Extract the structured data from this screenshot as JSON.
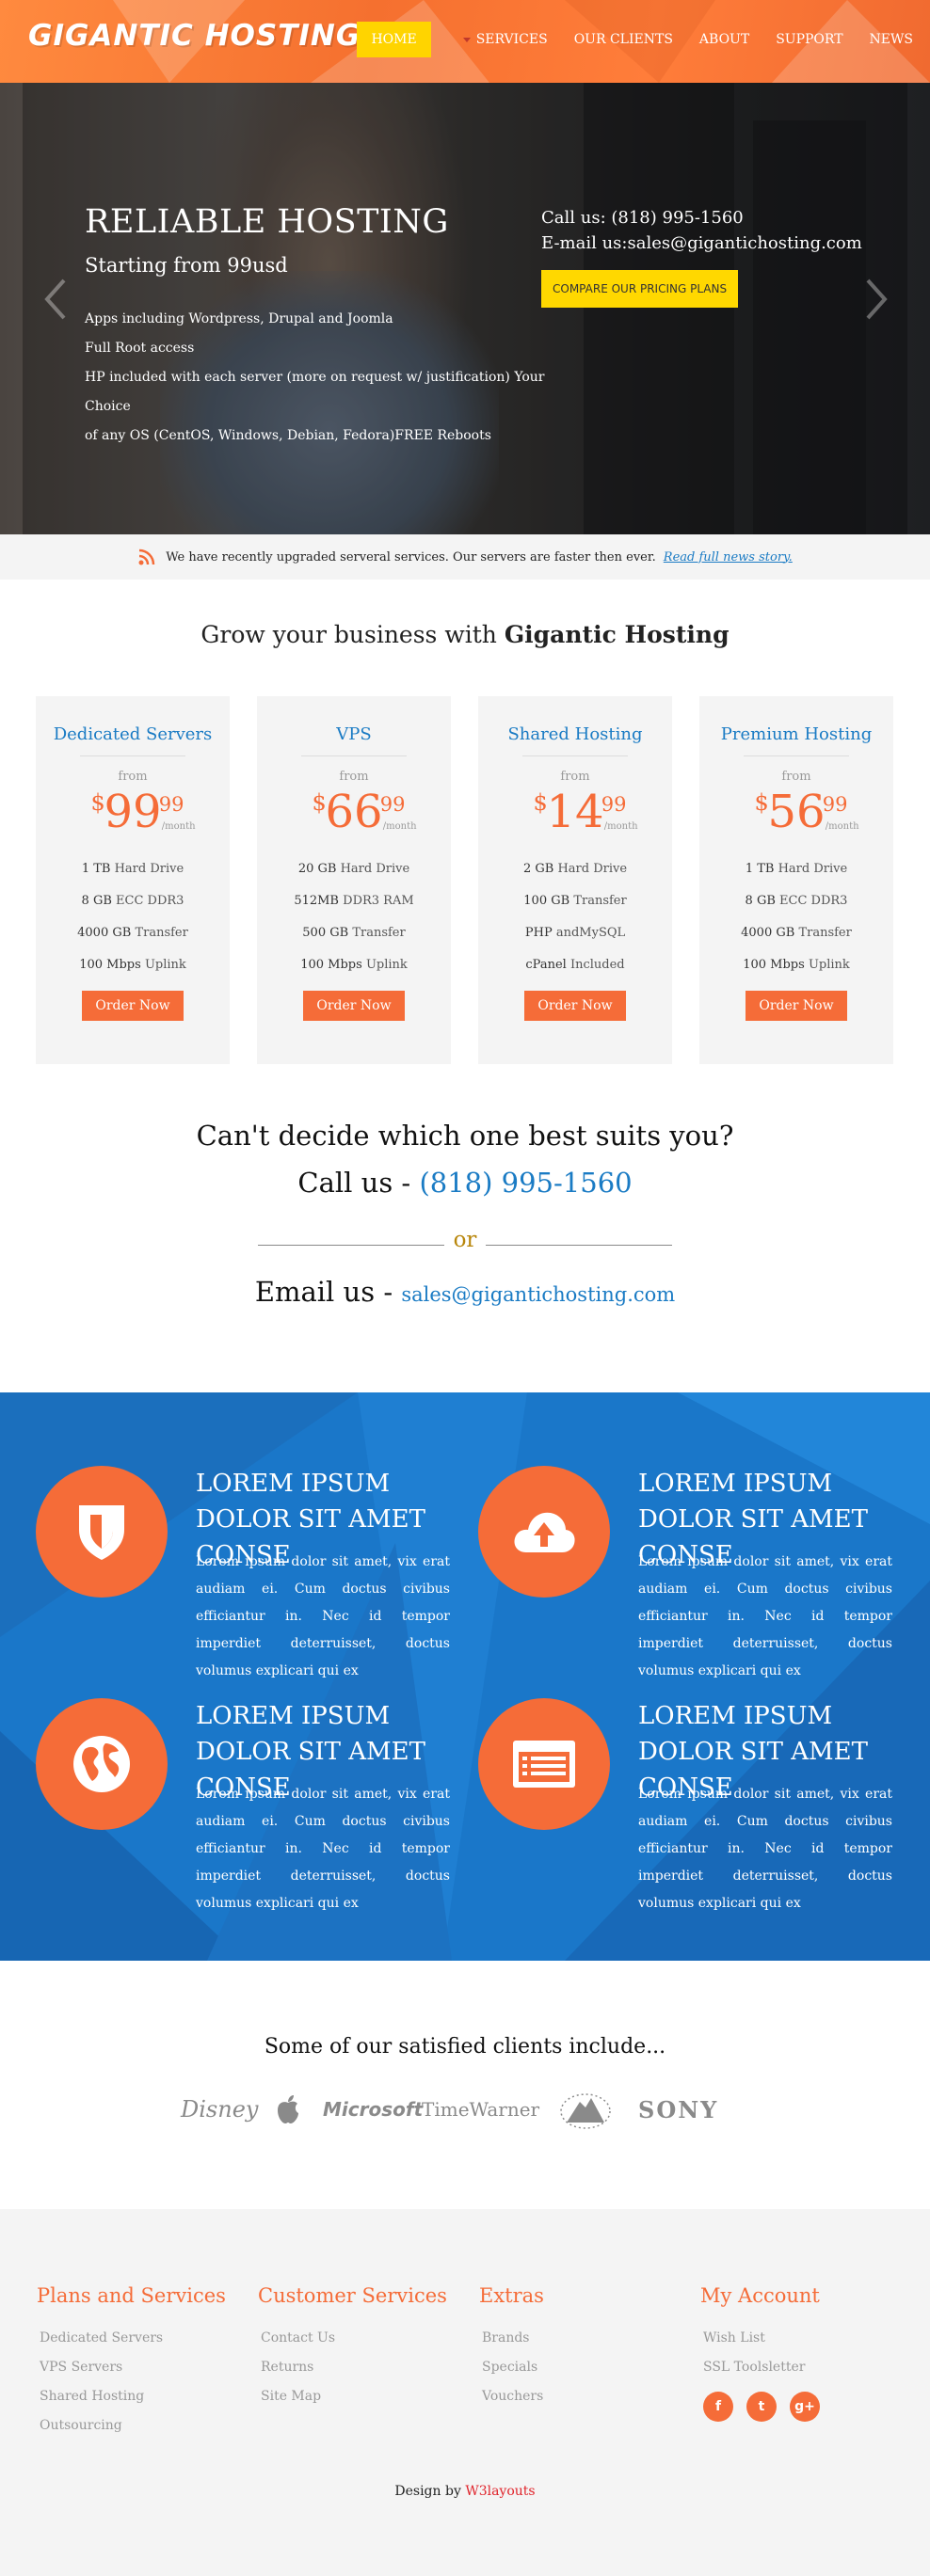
{
  "header": {
    "logo": "GIGANTIC HOSTING",
    "nav": [
      "HOME",
      "SERVICES",
      "OUR CLIENTS",
      "ABOUT",
      "SUPPORT",
      "NEWS"
    ]
  },
  "hero": {
    "title": "RELIABLE HOSTING",
    "subtitle": "Starting from 99usd",
    "features": [
      "Apps including Wordpress, Drupal and Joomla",
      "Full Root access",
      "HP included with each server (more on request w/ justification) Your Choice",
      "of any OS (CentOS, Windows, Debian, Fedora)FREE Reboots"
    ],
    "call_label": "Call us:",
    "call_number": "(818) 995-1560",
    "email_label": "E-mail us:",
    "email": "sales@gigantichosting.com",
    "cta": "COMPARE OUR PRICING PLANS"
  },
  "news": {
    "text": "We have recently upgraded serveral services. Our servers are faster then ever.",
    "link": "Read full news story."
  },
  "grow": {
    "prefix": "Grow your business with",
    "brand": "Gigantic Hosting"
  },
  "plans": [
    {
      "name": "Dedicated Servers",
      "from": "from",
      "currency": "$",
      "price": "99",
      "cents": "99",
      "per": "/month",
      "specs": [
        [
          "1 TB",
          "Hard Drive"
        ],
        [
          "8 GB",
          "ECC DDR3"
        ],
        [
          "4000 GB",
          "Transfer"
        ],
        [
          "100 Mbps",
          "Uplink"
        ]
      ],
      "order": "Order Now"
    },
    {
      "name": "VPS",
      "from": "from",
      "currency": "$",
      "price": "66",
      "cents": "99",
      "per": "/month",
      "specs": [
        [
          "20 GB",
          "Hard Drive"
        ],
        [
          "512MB",
          "DDR3 RAM"
        ],
        [
          "500 GB",
          "Transfer"
        ],
        [
          "100 Mbps",
          "Uplink"
        ]
      ],
      "order": "Order Now"
    },
    {
      "name": "Shared Hosting",
      "from": "from",
      "currency": "$",
      "price": "14",
      "cents": "99",
      "per": "/month",
      "specs": [
        [
          "2 GB",
          "Hard Drive"
        ],
        [
          "100 GB",
          "Transfer"
        ],
        [
          "PHP",
          "andMySQL"
        ],
        [
          "cPanel",
          "Included"
        ]
      ],
      "order": "Order Now"
    },
    {
      "name": "Premium Hosting",
      "from": "from",
      "currency": "$",
      "price": "56",
      "cents": "99",
      "per": "/month",
      "specs": [
        [
          "1 TB",
          "Hard Drive"
        ],
        [
          "8 GB",
          "ECC DDR3"
        ],
        [
          "4000 GB",
          "Transfer"
        ],
        [
          "100 Mbps",
          "Uplink"
        ]
      ],
      "order": "Order Now"
    }
  ],
  "contact": {
    "decide": "Can't decide which one best suits you?",
    "call_prefix": "Call us -",
    "call_number": "(818) 995-1560",
    "or": "or",
    "email_prefix": "Email us -",
    "email": "sales@gigantichosting.com"
  },
  "features": [
    {
      "icon": "shield-icon",
      "title": "LOREM IPSUM DOLOR SIT AMET CONSE",
      "text": "Lorem ipsum dolor sit amet, vix erat audiam ei. Cum doctus civibus efficiantur in. Nec id tempor imperdiet deterruisset, doctus volumus explicari qui ex"
    },
    {
      "icon": "cloud-upload-icon",
      "title": "LOREM IPSUM DOLOR SIT AMET CONSE",
      "text": "Lorem ipsum dolor sit amet, vix erat audiam ei. Cum doctus civibus efficiantur in. Nec id tempor imperdiet deterruisset, doctus volumus explicari qui ex"
    },
    {
      "icon": "globe-icon",
      "title": "LOREM IPSUM DOLOR SIT AMET CONSE",
      "text": "Lorem ipsum dolor sit amet, vix erat audiam ei. Cum doctus civibus efficiantur in. Nec id tempor imperdiet deterruisset, doctus volumus explicari qui ex"
    },
    {
      "icon": "browser-window-icon",
      "title": "LOREM IPSUM DOLOR SIT AMET CONSE",
      "text": "Lorem ipsum dolor sit amet, vix erat audiam ei. Cum doctus civibus efficiantur in. Nec id tempor imperdiet deterruisset, doctus volumus explicari qui ex"
    }
  ],
  "clients": {
    "title": "Some of our satisfied clients include...",
    "logos": [
      "Disney",
      "Microsoft",
      "TimeWarner",
      "SONY"
    ]
  },
  "footer": {
    "columns": [
      {
        "title": "Plans and Services",
        "links": [
          "Dedicated Servers",
          "VPS Servers",
          "Shared Hosting",
          "Outsourcing"
        ]
      },
      {
        "title": "Customer Services",
        "links": [
          "Contact Us",
          "Returns",
          "Site Map"
        ]
      },
      {
        "title": "Extras",
        "links": [
          "Brands",
          "Specials",
          "Vouchers"
        ]
      },
      {
        "title": "My Account",
        "links": [
          "Wish List",
          "SSL Toolsletter"
        ]
      }
    ],
    "social": [
      "f",
      "t",
      "g+"
    ],
    "credit_prefix": "Design by",
    "credit_link": "W3layouts"
  },
  "colors": {
    "accent": "#f56c38",
    "blue": "#1a77c9",
    "link": "#1a7bc4",
    "yellow": "#ffd800"
  }
}
